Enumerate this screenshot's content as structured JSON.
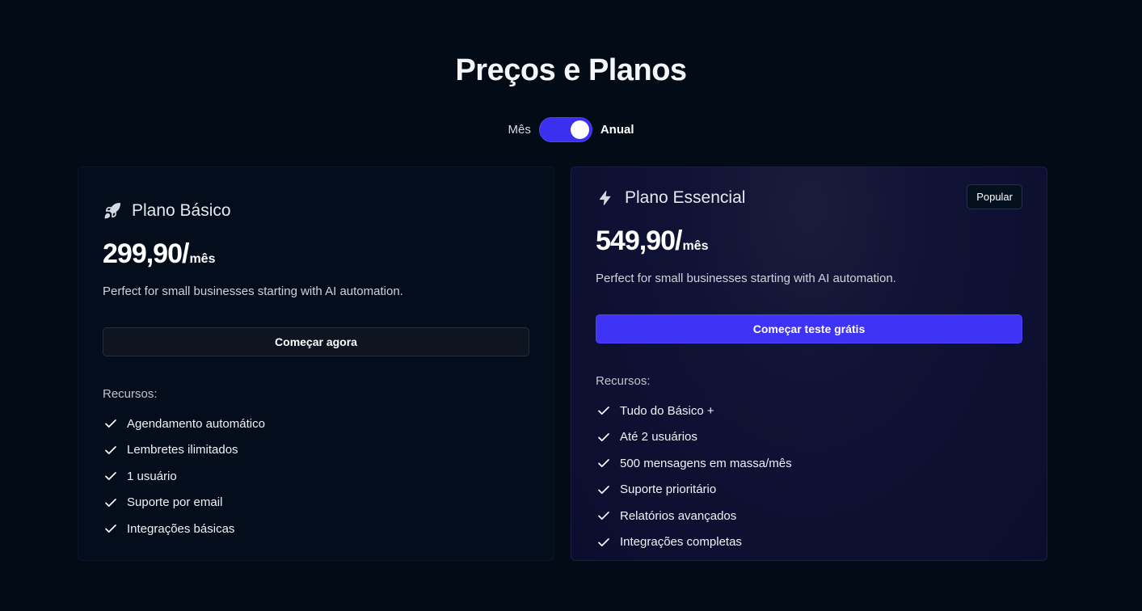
{
  "header": {
    "title": "Preços e Planos"
  },
  "billing_toggle": {
    "left_label": "Mês",
    "right_label": "Anual",
    "selected": "Anual"
  },
  "plans": [
    {
      "name": "Plano Básico",
      "icon": "rocket-icon",
      "price": "299,90/",
      "period": "mês",
      "description": "Perfect for small businesses starting with AI automation.",
      "cta": "Começar agora",
      "features_title": "Recursos:",
      "features": [
        "Agendamento automático",
        "Lembretes ilimitados",
        "1 usuário",
        "Suporte por email",
        "Integrações básicas"
      ]
    },
    {
      "name": "Plano Essencial",
      "icon": "lightning-icon",
      "badge": "Popular",
      "price": "549,90/",
      "period": "mês",
      "description": "Perfect for small businesses starting with AI automation.",
      "cta": "Começar teste grátis",
      "features_title": "Recursos:",
      "features": [
        "Tudo do Básico +",
        "Até 2 usuários",
        "500 mensagens em massa/mês",
        "Suporte prioritário",
        "Relatórios avançados",
        "Integrações completas"
      ]
    }
  ],
  "colors": {
    "background": "#020b16",
    "accent": "#3f33f5",
    "toggle": "#3b2ff0"
  }
}
